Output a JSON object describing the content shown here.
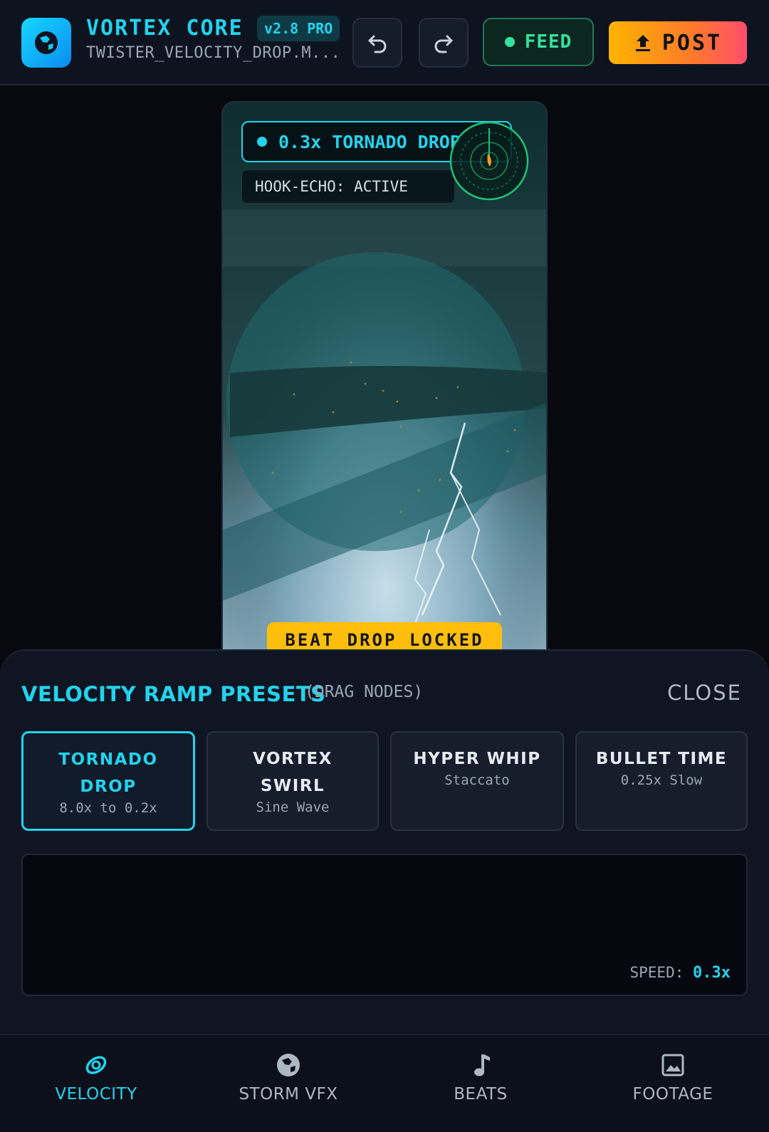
{
  "header": {
    "title": "VORTEX CORE",
    "version": "v2.8 PRO",
    "filename": "TWISTER_VELOCITY_DROP.M...",
    "feed_label": "FEED",
    "post_label": "POST"
  },
  "preview": {
    "speed_label": "0.3x TORNADO DROP",
    "hook_echo": "HOOK-ECHO: ACTIVE",
    "beat_badge": "BEAT DROP LOCKED"
  },
  "panel": {
    "title": "VELOCITY RAMP PRESETS",
    "subtitle": "(DRAG NODES)",
    "close_label": "CLOSE",
    "presets": [
      {
        "name": "TORNADO DROP",
        "desc": "8.0x to 0.2x"
      },
      {
        "name": "VORTEX SWIRL",
        "desc": "Sine Wave"
      },
      {
        "name": "HYPER WHIP",
        "desc": "Staccato"
      },
      {
        "name": "BULLET TIME",
        "desc": "0.25x Slow"
      }
    ],
    "speed_label": "SPEED:",
    "speed_value": "0.3x"
  },
  "nav": {
    "items": [
      {
        "label": "VELOCITY",
        "icon": "velocity-icon"
      },
      {
        "label": "STORM VFX",
        "icon": "globe-icon"
      },
      {
        "label": "BEATS",
        "icon": "music-note-icon"
      },
      {
        "label": "FOOTAGE",
        "icon": "image-icon"
      }
    ]
  },
  "colors": {
    "accent": "#22d3ee",
    "feed_green": "#34e39a",
    "post_gradient_start": "#ffb400",
    "post_gradient_end": "#ff4d6d",
    "badge_yellow": "#ffbe0b"
  }
}
